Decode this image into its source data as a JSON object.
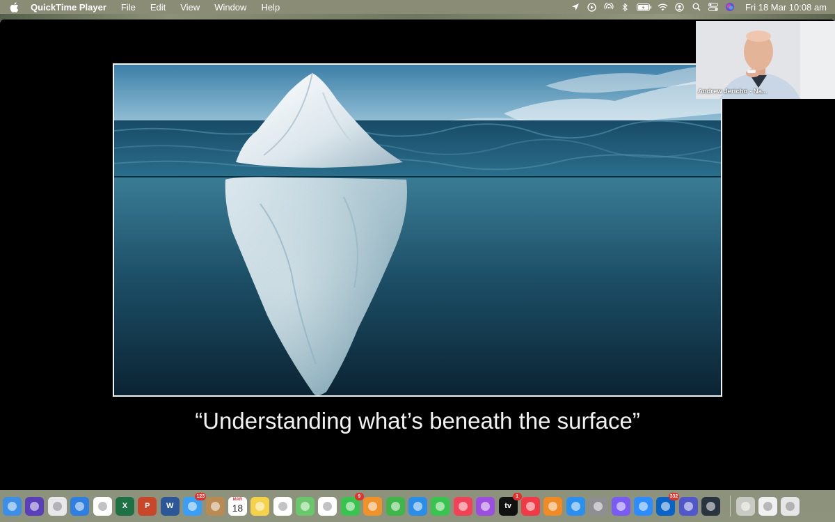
{
  "menubar": {
    "app_name": "QuickTime Player",
    "items": [
      "File",
      "Edit",
      "View",
      "Window",
      "Help"
    ],
    "clock": "Fri 18 Mar  10:08 am",
    "status_icons": [
      "location-arrow-icon",
      "play-circle-icon",
      "airdrop-icon",
      "bluetooth-icon",
      "battery-icon",
      "wifi-icon",
      "user-icon",
      "search-icon",
      "control-center-icon",
      "siri-icon"
    ]
  },
  "slide": {
    "caption": "“Understanding what’s beneath the surface”",
    "image": "iceberg-image"
  },
  "video_tile": {
    "participant_name": "Andrew Jericho - Na..."
  },
  "dock": {
    "apps": [
      {
        "name": "finder-icon",
        "color": "#3d8ee6"
      },
      {
        "name": "siri-icon",
        "color": "#5a3fb8"
      },
      {
        "name": "launchpad-icon",
        "color": "#e8e8ea"
      },
      {
        "name": "safari-icon",
        "color": "#2f7fe0"
      },
      {
        "name": "chrome-icon",
        "color": "#ffffff"
      },
      {
        "name": "excel-icon",
        "color": "#1e7145",
        "label": "X"
      },
      {
        "name": "powerpoint-icon",
        "color": "#c8462a",
        "label": "P"
      },
      {
        "name": "word-icon",
        "color": "#2b5797",
        "label": "W"
      },
      {
        "name": "mail-icon",
        "color": "#3b9ef5",
        "badge": "123"
      },
      {
        "name": "contacts-icon",
        "color": "#b98b53"
      },
      {
        "name": "calendar-icon",
        "color": "#ffffff",
        "month": "MAR",
        "day": "18"
      },
      {
        "name": "notes-icon",
        "color": "#f6d24a"
      },
      {
        "name": "reminders-icon",
        "color": "#ffffff"
      },
      {
        "name": "maps-icon",
        "color": "#6bc76b"
      },
      {
        "name": "photos-icon",
        "color": "#ffffff"
      },
      {
        "name": "messages-icon",
        "color": "#39c44f",
        "badge": "9"
      },
      {
        "name": "pages-icon",
        "color": "#f0922c"
      },
      {
        "name": "numbers-icon",
        "color": "#3fb54a"
      },
      {
        "name": "keynote-icon",
        "color": "#2c8de6"
      },
      {
        "name": "facetime-icon",
        "color": "#38c44e"
      },
      {
        "name": "music-icon",
        "color": "#f24257"
      },
      {
        "name": "podcasts-icon",
        "color": "#9b4ee0"
      },
      {
        "name": "apple-tv-icon",
        "color": "#111111",
        "label": "tv",
        "badge": "1"
      },
      {
        "name": "news-icon",
        "color": "#f03a45"
      },
      {
        "name": "books-icon",
        "color": "#f08a24"
      },
      {
        "name": "app-store-icon",
        "color": "#2b8ff0"
      },
      {
        "name": "system-preferences-icon",
        "color": "#8e8e93"
      },
      {
        "name": "messenger-icon",
        "color": "#7a5cf5"
      },
      {
        "name": "zoom-icon",
        "color": "#2d8cff"
      },
      {
        "name": "outlook-icon",
        "color": "#0a64c6",
        "badge": "332"
      },
      {
        "name": "teams-icon",
        "color": "#5058c9"
      },
      {
        "name": "quicktime-icon",
        "color": "#2a3440"
      }
    ],
    "right_items": [
      {
        "name": "help-icon",
        "color": "#c9cbc2"
      },
      {
        "name": "downloads-stack-icon",
        "color": "#f0f0f0"
      },
      {
        "name": "trash-icon",
        "color": "#e6e6e6"
      }
    ],
    "colors": {
      "accent": "#e0312a"
    }
  }
}
